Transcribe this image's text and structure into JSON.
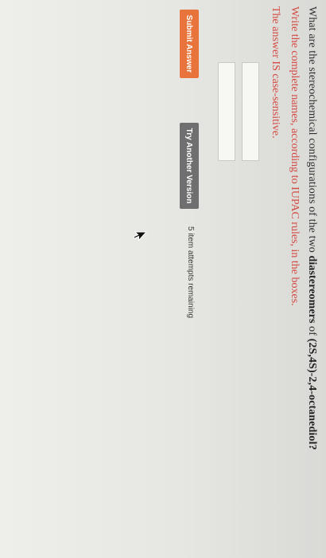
{
  "question": {
    "prefix": "What are the stereochemical configurations of the two ",
    "bold_term": "diastereomers",
    "middle": " of ",
    "compound": "(2S,4S)-2,4-octanediol?"
  },
  "instructions": {
    "line1": "Write the complete names, according to IUPAC rules, in the boxes.",
    "line2": "The answer IS case-sensitive."
  },
  "answers": {
    "box1_value": "",
    "box2_value": ""
  },
  "actions": {
    "submit_label": "Submit Answer",
    "try_another_label": "Try Another Version",
    "attempts_text": "5 item attempts remaining"
  },
  "colors": {
    "instruction_text": "#d44a43",
    "submit_button": "#e8733b",
    "try_button": "#6f6f6f"
  },
  "icons": {
    "cursor": "mouse-pointer-icon"
  }
}
